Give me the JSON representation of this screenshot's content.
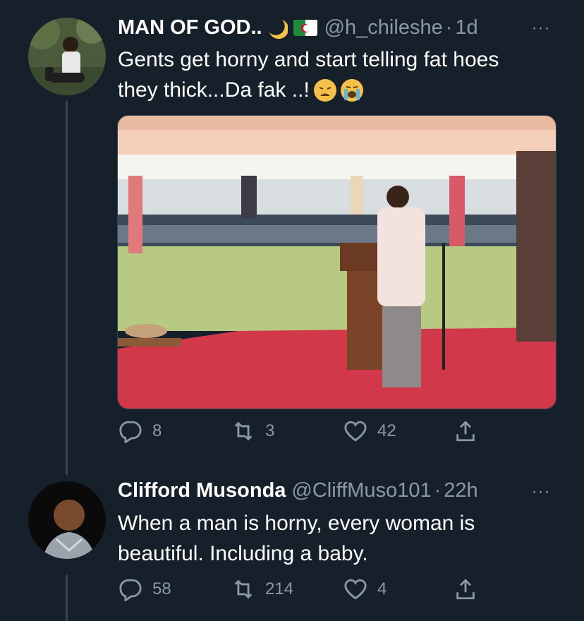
{
  "tweets": [
    {
      "display_name": "MAN OF GOD..",
      "handle": "@h_chileshe",
      "separator": "·",
      "time": "1d",
      "text_line1": "Gents get horny and start telling fat hoes",
      "text_line2": "they thick...Da fak ..!",
      "stats": {
        "replies": "8",
        "retweets": "3",
        "likes": "42"
      }
    },
    {
      "display_name": "Clifford Musonda",
      "handle": "@CliffMuso101",
      "separator": "·",
      "time": "22h",
      "text_line1": "When a man is horny, every woman is",
      "text_line2": "beautiful. Including a baby.",
      "stats": {
        "replies": "58",
        "retweets": "214",
        "likes": "4"
      }
    }
  ],
  "more_label": "···",
  "icons": {
    "reply": "reply-icon",
    "retweet": "retweet-icon",
    "like": "heart-icon",
    "share": "share-icon",
    "moon": "crescent-moon-emoji",
    "flag": "algeria-flag-emoji",
    "weary": "weary-face-emoji",
    "crying": "loudly-crying-face-emoji"
  },
  "colors": {
    "background": "#15202b",
    "secondary_text": "#8b98a5",
    "thread_line": "#38444d"
  }
}
